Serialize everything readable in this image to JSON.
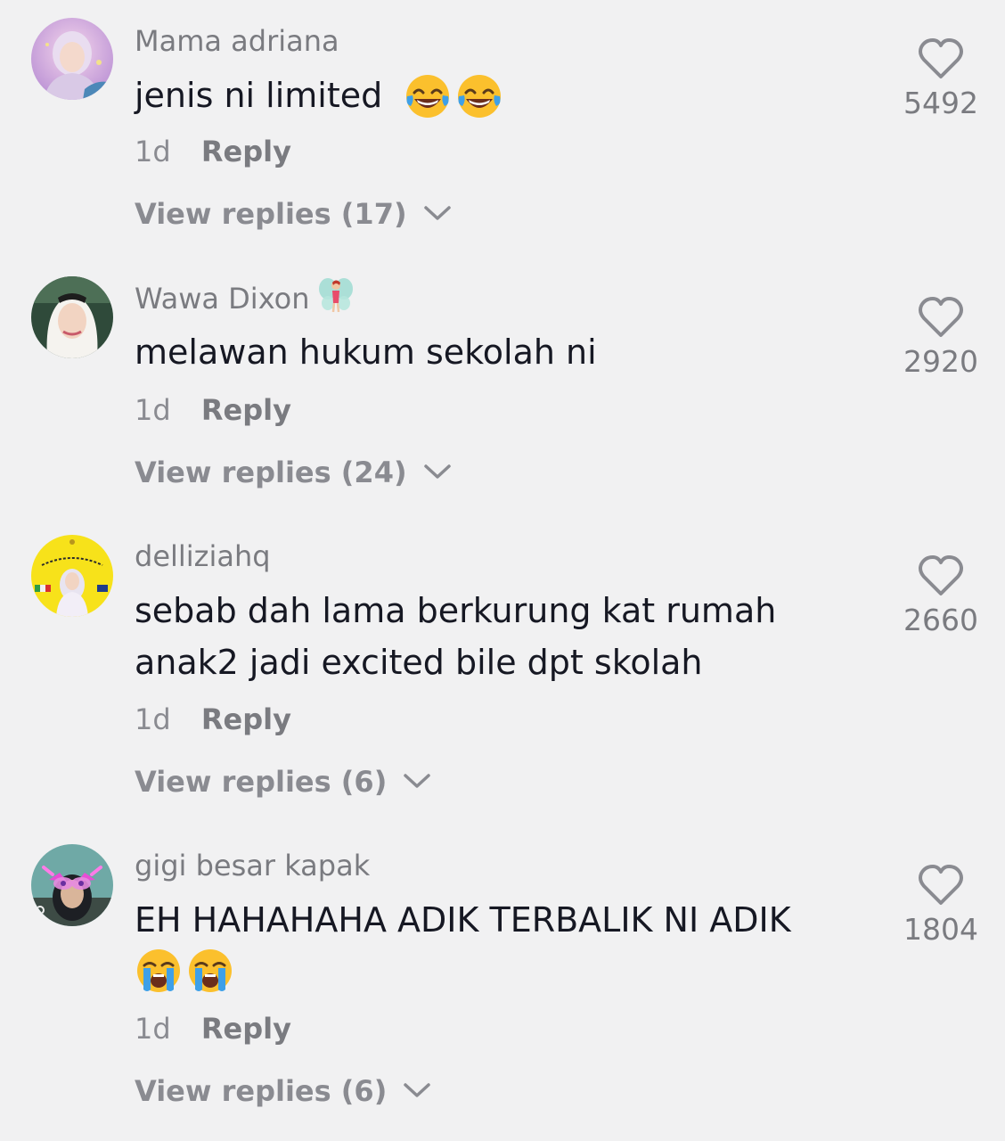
{
  "comments": [
    {
      "username": "Mama adriana",
      "username_emoji": "",
      "text": "jenis ni limited",
      "text_line2": "",
      "emojis": [
        "face-with-tears-of-joy",
        "face-with-tears-of-joy"
      ],
      "time": "1d",
      "reply_label": "Reply",
      "view_replies": "View replies (17)",
      "likes": "5492"
    },
    {
      "username": "Wawa Dixon",
      "username_emoji": "fairy",
      "text": "melawan hukum sekolah ni",
      "text_line2": "",
      "emojis": [],
      "time": "1d",
      "reply_label": "Reply",
      "view_replies": "View replies (24)",
      "likes": "2920"
    },
    {
      "username": "delliziahq",
      "username_emoji": "",
      "text": "sebab dah lama berkurung kat rumah",
      "text_line2": "anak2 jadi excited bile dpt skolah",
      "emojis": [],
      "time": "1d",
      "reply_label": "Reply",
      "view_replies": "View replies (6)",
      "likes": "2660"
    },
    {
      "username": "gigi besar kapak",
      "username_emoji": "",
      "text": "EH HAHAHAHA ADIK TERBALIK NI ADIK",
      "text_line2": "",
      "emojis": [
        "loudly-crying-face",
        "loudly-crying-face"
      ],
      "time": "1d",
      "reply_label": "Reply",
      "view_replies": "View replies (6)",
      "likes": "1804"
    }
  ],
  "colors": {
    "background": "#f1f1f2",
    "text": "#161823",
    "muted": "#7a7b80"
  },
  "icons": {
    "like": "heart-outline-icon",
    "expand": "chevron-down-icon"
  }
}
